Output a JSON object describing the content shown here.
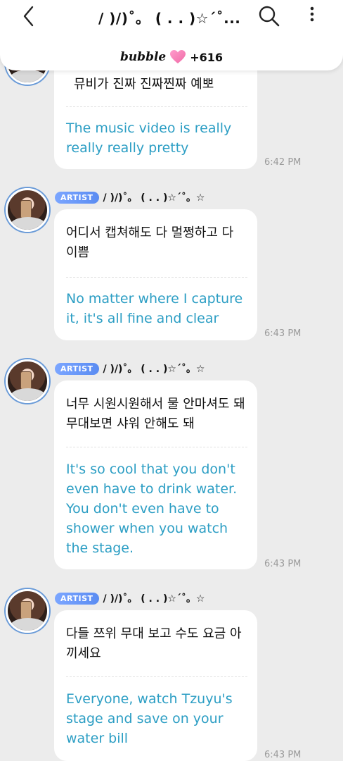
{
  "header": {
    "title": "/ )/)˚。 ( . . )☆´˚...",
    "bubble_logo": "bubble",
    "bubble_count": "+616"
  },
  "icons": {
    "back": "chevron-left-icon",
    "search": "search-icon",
    "more": "more-vertical-icon",
    "heart": "heart-icon"
  },
  "colors": {
    "translation": "#2c9ec4",
    "badge": "#5a8cf2",
    "heart": "#f06aa6",
    "background": "#ececec"
  },
  "messages": [
    {
      "korean": "뮤비가 진짜 진짜찐짜 예뽀",
      "english": "The music video is really really really pretty",
      "time": "6:42 PM"
    },
    {
      "badge": "ARTIST",
      "sender": "/ )/)˚。 ( . . )☆´˚。☆",
      "korean": "어디서 캡쳐해도 다 멀쩡하고 다 이쁨",
      "english": "No matter where I capture it, it's all fine and clear",
      "time": "6:43 PM"
    },
    {
      "badge": "ARTIST",
      "sender": "/ )/)˚。 ( . . )☆´˚。☆",
      "korean": "너무 시원시원해서 물 안마셔도 돼 무대보면 샤워 안해도 돼",
      "english": "It's so cool that you don't even have to drink water. You don't even have to shower when you watch the stage.",
      "time": "6:43 PM"
    },
    {
      "badge": "ARTIST",
      "sender": "/ )/)˚。 ( . . )☆´˚。☆",
      "korean": " 다들 쯔위 무대 보고 수도 요금 아끼세요",
      "english": "Everyone, watch Tzuyu's stage and save on your water bill",
      "time": "6:43 PM"
    }
  ]
}
